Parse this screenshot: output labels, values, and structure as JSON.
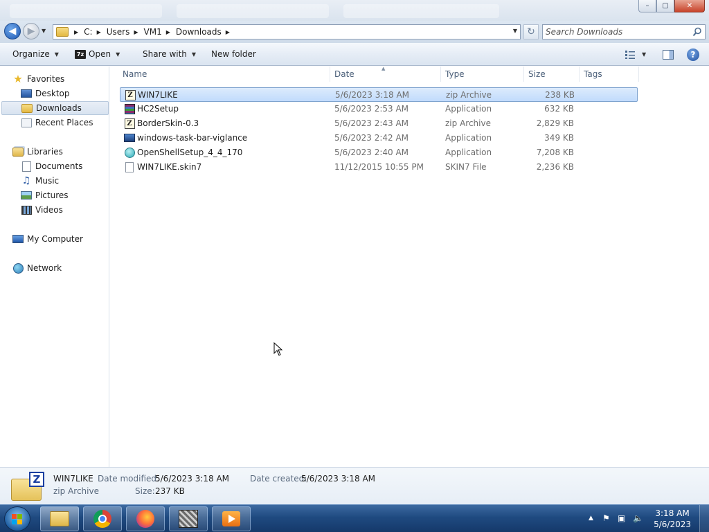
{
  "window": {
    "minimize_glyph": "–",
    "maximize_glyph": "▢",
    "close_glyph": "✕"
  },
  "address_bar": {
    "breadcrumbs": [
      "C:",
      "Users",
      "VM1",
      "Downloads"
    ],
    "search_placeholder": "Search Downloads",
    "refresh_icon": "refresh-icon",
    "search_icon": "search-icon"
  },
  "toolbar": {
    "organize_label": "Organize",
    "open_label": "Open",
    "share_label": "Share with",
    "new_folder_label": "New folder",
    "open_icon_text": "7z"
  },
  "nav": {
    "favorites": "Favorites",
    "desktop": "Desktop",
    "downloads": "Downloads",
    "recent": "Recent Places",
    "libraries": "Libraries",
    "documents": "Documents",
    "music": "Music",
    "pictures": "Pictures",
    "videos": "Videos",
    "computer": "My Computer",
    "network": "Network"
  },
  "columns": {
    "name": "Name",
    "date": "Date",
    "type": "Type",
    "size": "Size",
    "tags": "Tags"
  },
  "files": [
    {
      "name": "WIN7LIKE",
      "date": "5/6/2023 3:18 AM",
      "type": "zip Archive",
      "size": "238 KB",
      "icon": "zip-icon"
    },
    {
      "name": "HC2Setup",
      "date": "5/6/2023 2:53 AM",
      "type": "Application",
      "size": "632 KB",
      "icon": "installer-icon"
    },
    {
      "name": "BorderSkin-0.3",
      "date": "5/6/2023 2:43 AM",
      "type": "zip Archive",
      "size": "2,829 KB",
      "icon": "zip-icon"
    },
    {
      "name": "windows-task-bar-viglance",
      "date": "5/6/2023 2:42 AM",
      "type": "Application",
      "size": "349 KB",
      "icon": "application-icon"
    },
    {
      "name": "OpenShellSetup_4_4_170",
      "date": "5/6/2023 2:40 AM",
      "type": "Application",
      "size": "7,208 KB",
      "icon": "shell-icon"
    },
    {
      "name": "WIN7LIKE.skin7",
      "date": "11/12/2015 10:55 PM",
      "type": "SKIN7 File",
      "size": "2,236 KB",
      "icon": "file-icon"
    }
  ],
  "details": {
    "name": "WIN7LIKE",
    "type": "zip Archive",
    "modified_label": "Date modified:",
    "modified_value": "5/6/2023 3:18 AM",
    "created_label": "Date created:",
    "created_value": "5/6/2023 3:18 AM",
    "size_label": "Size:",
    "size_value": "237 KB",
    "icon_letter": "Z"
  },
  "taskbar": {
    "time": "3:18 AM",
    "date": "5/6/2023"
  },
  "colors": {
    "selection_border": "#7da2ce",
    "taskbar": "#1f4a80",
    "accent_blue": "#1d58b3"
  }
}
